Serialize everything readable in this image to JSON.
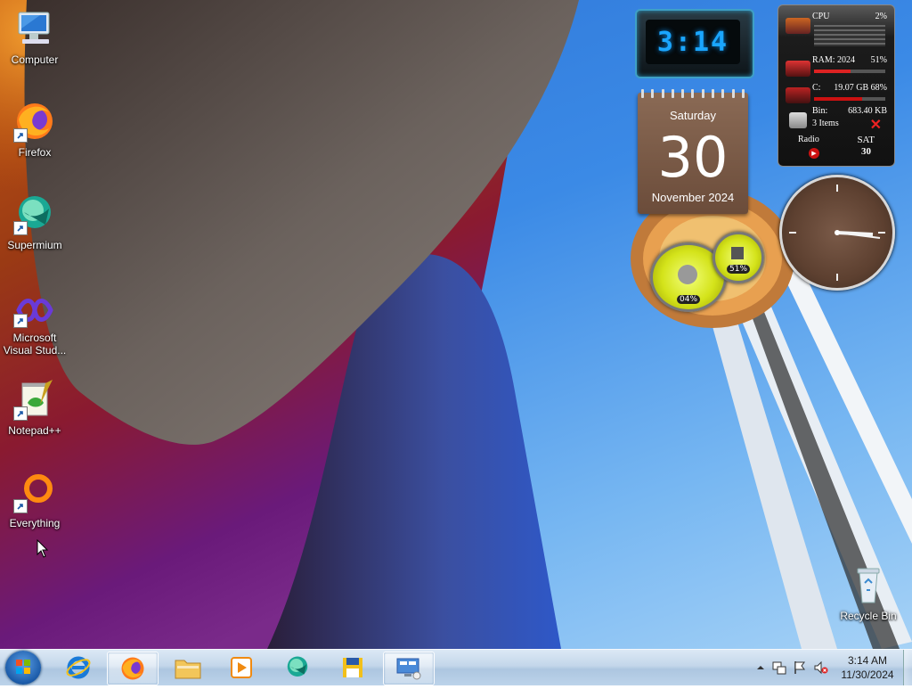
{
  "desktop": {
    "icons": [
      {
        "label": "Computer",
        "icon": "computer-icon"
      },
      {
        "label": "Firefox",
        "icon": "firefox-icon"
      },
      {
        "label": "Supermium",
        "icon": "supermium-icon"
      },
      {
        "label": "Microsoft Visual Stud...",
        "icon": "visual-studio-icon"
      },
      {
        "label": "Notepad++",
        "icon": "notepad-plus-plus-icon"
      },
      {
        "label": "Everything",
        "icon": "everything-icon"
      },
      {
        "label": "Recycle Bin",
        "icon": "recycle-bin-icon"
      }
    ]
  },
  "gadgets": {
    "digital_clock": {
      "time": "3:14"
    },
    "calendar": {
      "day_name": "Saturday",
      "day": "30",
      "month_year": "November 2024"
    },
    "system_monitor": {
      "cpu_label": "CPU",
      "cpu_value": "2%",
      "cpu_level": 0.02,
      "ram_label": "RAM: 2024",
      "ram_value": "51%",
      "ram_level": 0.51,
      "disk_label": "C:",
      "disk_value": "19.07 GB 68%",
      "disk_level": 0.68,
      "bin_label": "Bin:",
      "bin_value": "683.40 KB",
      "bin_items": "3 Items",
      "radio_label": "Radio",
      "day_abbr": "SAT",
      "day_num": "30"
    },
    "meters": {
      "cpu_meter": "04%",
      "memory_meter": "51%"
    }
  },
  "taskbar": {
    "start": "start-orb-icon",
    "pinned": [
      {
        "name": "internet-explorer",
        "icon": "internet-explorer-icon",
        "active": false
      },
      {
        "name": "firefox",
        "icon": "firefox-icon",
        "active": true
      },
      {
        "name": "file-explorer",
        "icon": "folder-icon",
        "active": false
      },
      {
        "name": "media-player",
        "icon": "media-player-icon",
        "active": false
      },
      {
        "name": "supermium",
        "icon": "supermium-icon",
        "active": false
      },
      {
        "name": "save-app",
        "icon": "floppy-icon",
        "active": false
      },
      {
        "name": "remote-desktop",
        "icon": "remote-desktop-icon",
        "active": true
      }
    ],
    "tray": {
      "time": "3:14 AM",
      "date": "11/30/2024",
      "icons": [
        "show-hidden-icons-icon",
        "network-icon",
        "action-center-flag-icon",
        "volume-muted-icon"
      ]
    }
  },
  "colors": {
    "taskbar_bg": "#c3d6ea",
    "digital_clock_text": "#1aa6ff",
    "calendar_bg": "#7a5a47",
    "meter_yellow": "#d4e31a"
  }
}
